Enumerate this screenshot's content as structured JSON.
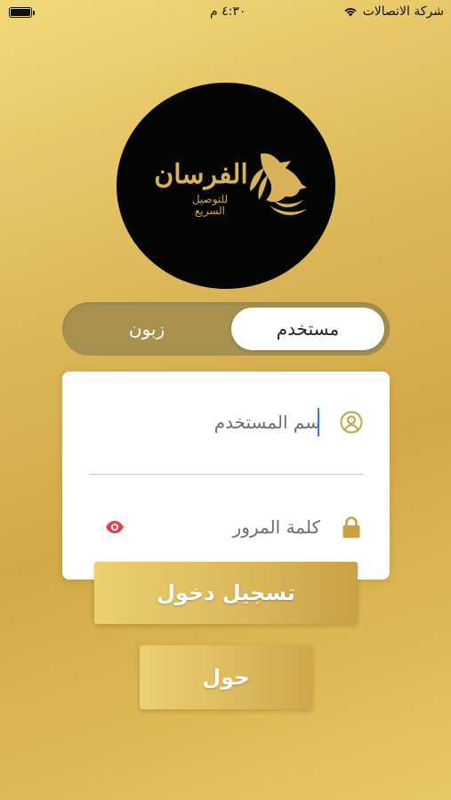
{
  "status_bar": {
    "carrier": "شركة الاتصالات",
    "time": "٤:٣٠ م",
    "wifi_icon": "wifi-icon",
    "battery_icon": "battery-icon"
  },
  "logo": {
    "title": "الفرسان",
    "subtitle_line1": "للتوصيل",
    "subtitle_line2": "السريع",
    "icon": "horse-head-icon",
    "colors": {
      "background": "#050505",
      "gold": "#d9b15a"
    }
  },
  "segment": {
    "active_label": "مستخدم",
    "inactive_label": "زبون"
  },
  "form": {
    "username": {
      "placeholder": "سم المستخدم",
      "value": "",
      "icon": "user-circle-icon"
    },
    "password": {
      "placeholder": "كلمة المرور",
      "value": "",
      "icon": "lock-icon",
      "toggle_icon": "eye-icon"
    }
  },
  "buttons": {
    "login_label": "تسجيل دخول",
    "about_label": "حول"
  },
  "colors": {
    "accent": "#d2a946",
    "icon_gold": "#c9a143",
    "eye_red": "#e0434b",
    "caret_blue": "#2b7cf6"
  }
}
